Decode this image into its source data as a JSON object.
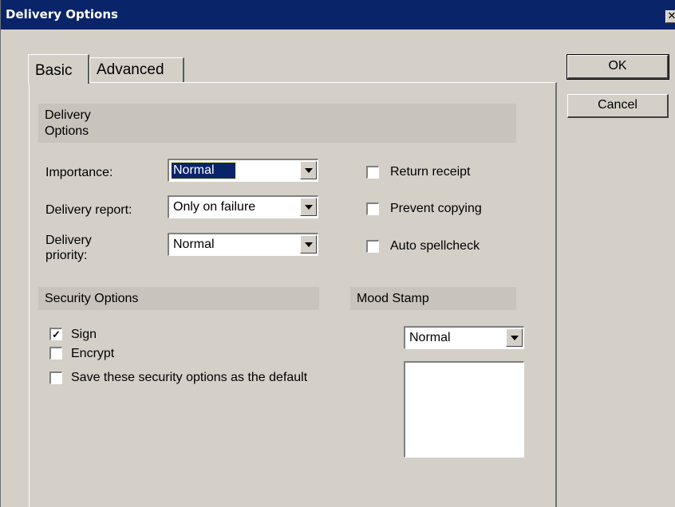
{
  "window": {
    "title": "Delivery Options",
    "close_glyph": "✕"
  },
  "tabs": [
    {
      "label": "Basic",
      "active": true
    },
    {
      "label": "Advanced",
      "active": false
    }
  ],
  "buttons": {
    "ok": "OK",
    "cancel": "Cancel"
  },
  "delivery_options": {
    "heading": "Delivery Options",
    "importance": {
      "label": "Importance:",
      "value": "Normal"
    },
    "delivery_report": {
      "label": "Delivery report:",
      "value": "Only on failure"
    },
    "delivery_priority": {
      "label": "Delivery priority:",
      "value": "Normal"
    },
    "checkboxes": [
      {
        "label": "Return receipt",
        "checked": false
      },
      {
        "label": "Prevent copying",
        "checked": false
      },
      {
        "label": "Auto spellcheck",
        "checked": false
      }
    ]
  },
  "security_options": {
    "heading": "Security Options",
    "checkboxes": [
      {
        "label": "Sign",
        "checked": true
      },
      {
        "label": "Encrypt",
        "checked": false
      },
      {
        "label": "Save these security options as the default",
        "checked": false
      }
    ]
  },
  "mood_stamp": {
    "heading": "Mood Stamp",
    "value": "Normal"
  },
  "colors": {
    "titlebar": "#0a246a",
    "face": "#d4d0c8",
    "selection": "#0a246a"
  }
}
